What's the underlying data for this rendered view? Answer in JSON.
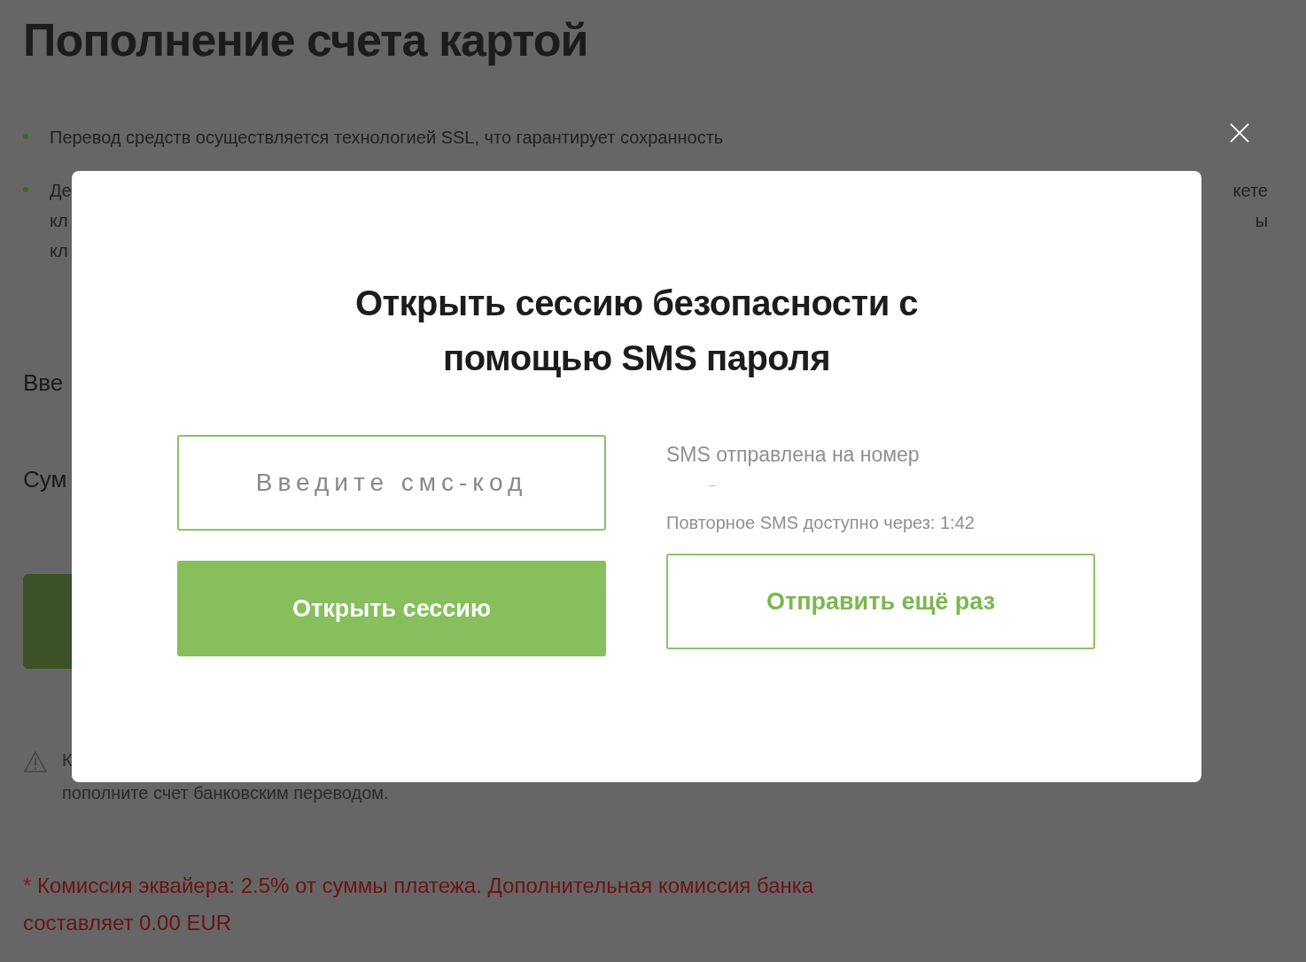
{
  "page": {
    "title": "Пополнение счета картой",
    "bullets": [
      {
        "lines": [
          {
            "start": "Перевод средств осуществляется технологией SSL, что гарантирует сохранность"
          }
        ]
      },
      {
        "lines": [
          {
            "start": "Де",
            "end": "кете"
          },
          {
            "start": "кл",
            "end": "ы"
          },
          {
            "start": "кл"
          }
        ]
      }
    ],
    "fields": [
      {
        "label": "Вве"
      },
      {
        "label": "Сум"
      }
    ],
    "warning": {
      "lines": [
        "К",
        "пополните счет банковским переводом."
      ]
    },
    "commission": {
      "mark": "*",
      "text": "Комиссия эквайера: 2.5% от суммы платежа. Дополнительная комиссия банка составляет 0.00 EUR"
    }
  },
  "modal": {
    "title": "Открыть сессию безопасности с помощью SMS пароля",
    "code_field": {
      "placeholder": "Введите смс-код"
    },
    "open_button": "Открыть сессию",
    "sms_sent_label": "SMS отправлена на номер",
    "phone": "–",
    "resend_timer": "Повторное SMS доступно через: 1:42",
    "resend_button": "Отправить ещё раз"
  }
}
